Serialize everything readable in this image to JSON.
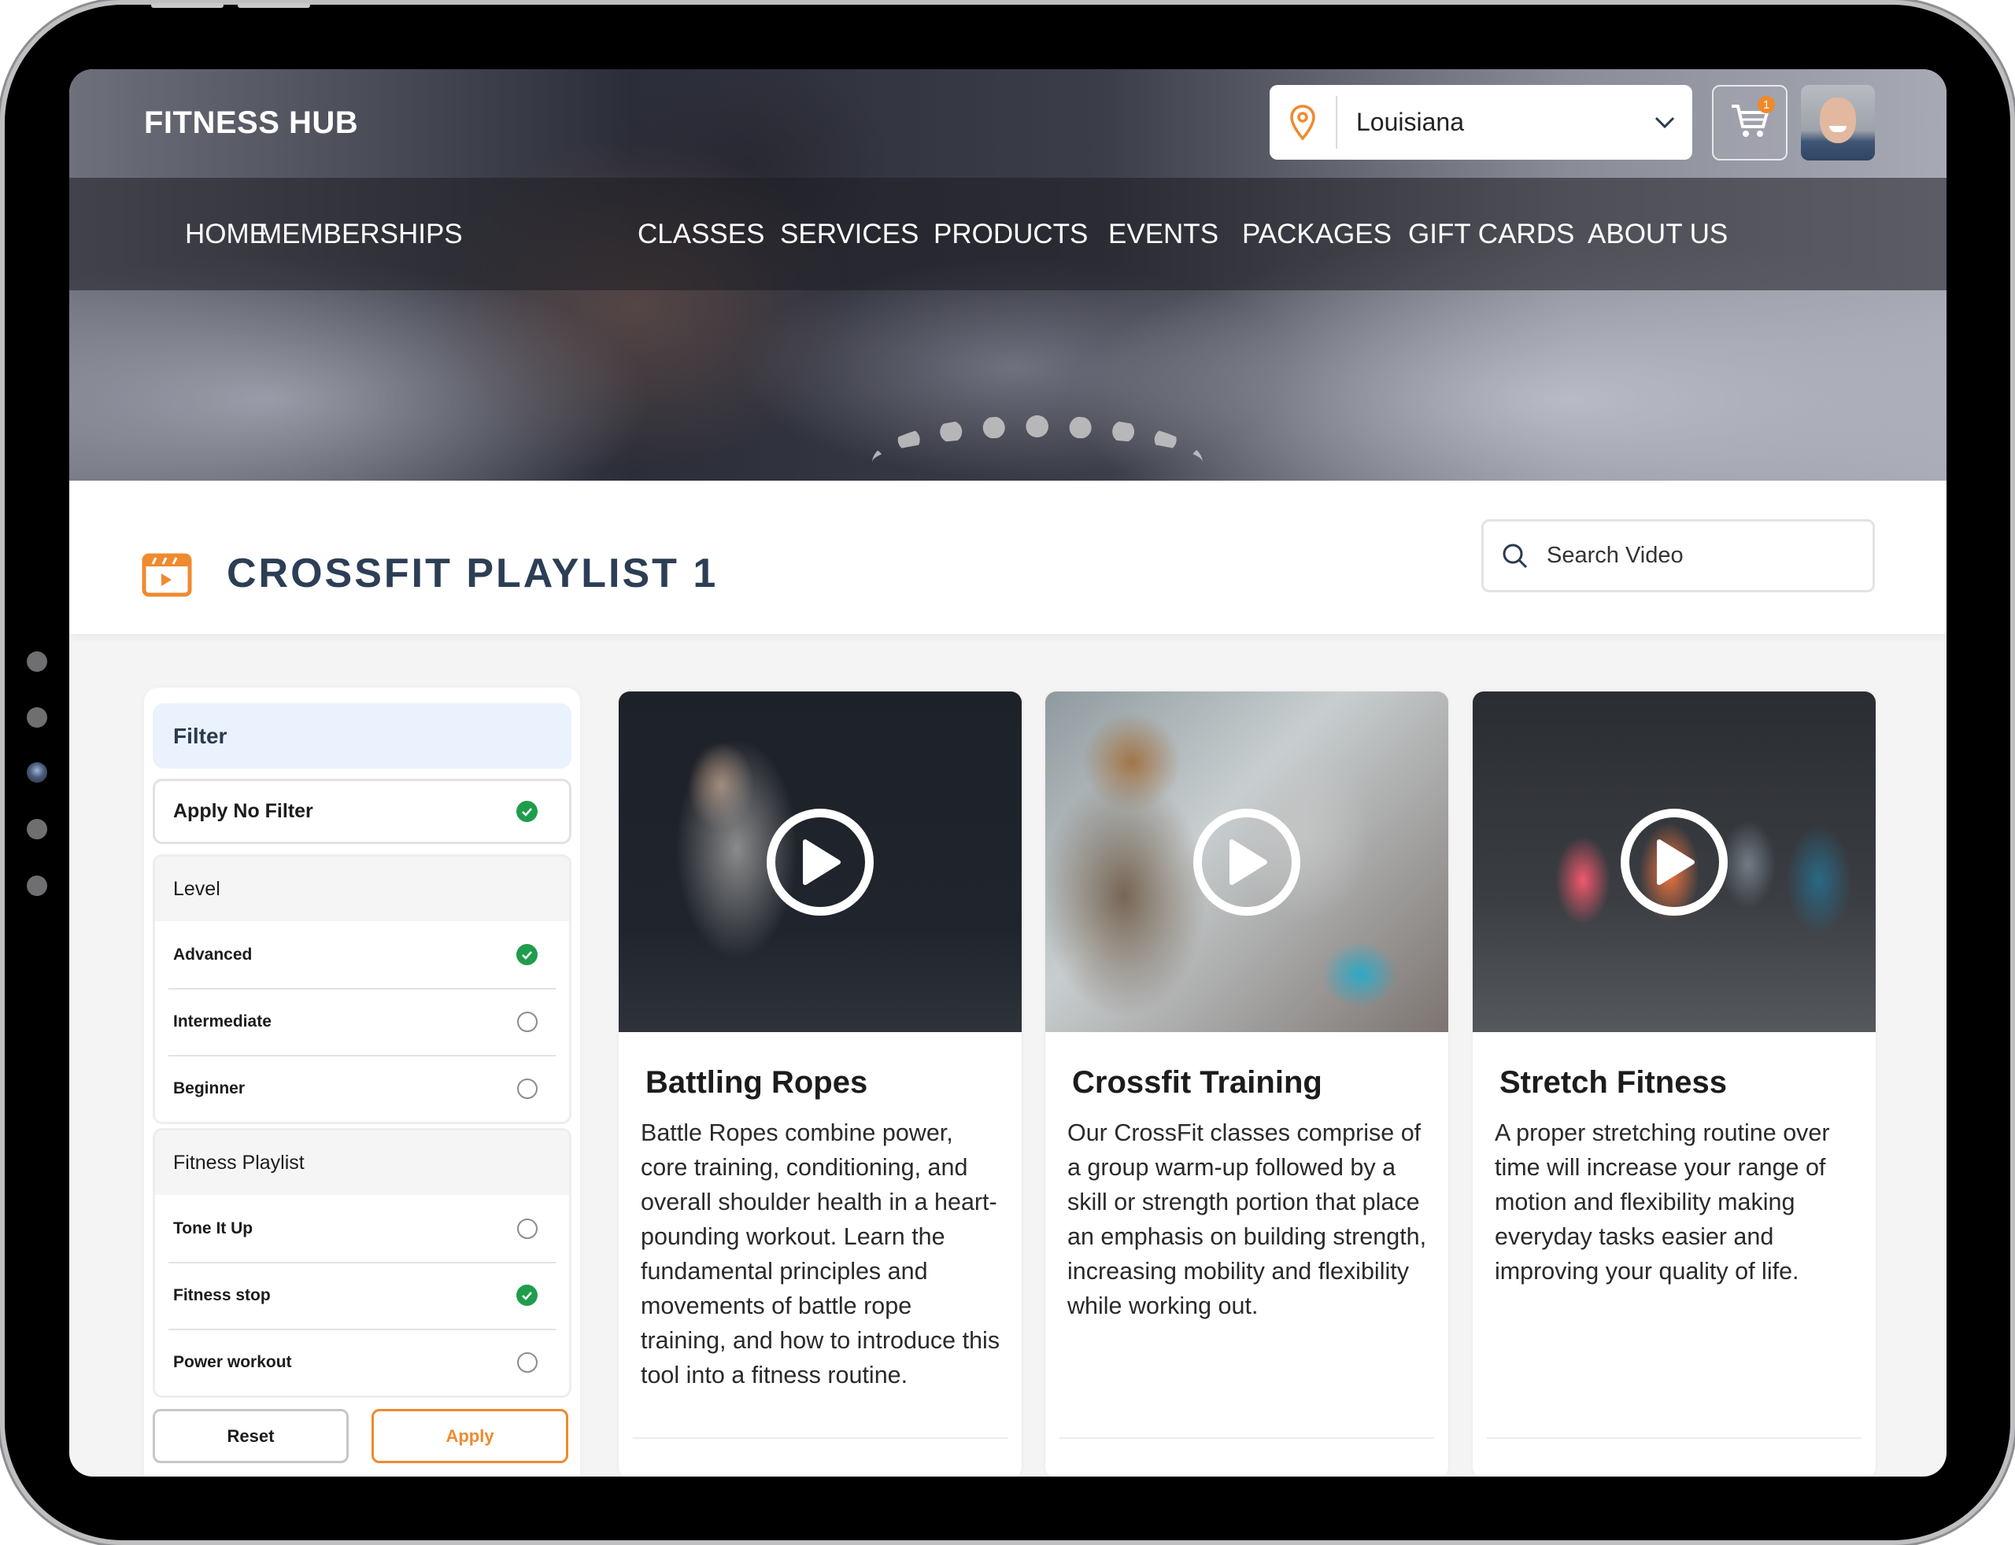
{
  "header": {
    "logo": "FITNESS HUB",
    "location": {
      "icon": "map-pin-icon",
      "value": "Louisiana",
      "dropdown_icon": "chevron-down-icon"
    },
    "cart": {
      "icon": "cart-icon",
      "badge_count": "1"
    },
    "avatar": "user-avatar"
  },
  "nav": {
    "items": [
      {
        "label": "HOME"
      },
      {
        "label": "MEMBERSHIPS"
      },
      {
        "label": "CLASSES"
      },
      {
        "label": "SERVICES"
      },
      {
        "label": "PRODUCTS"
      },
      {
        "label": "EVENTS"
      },
      {
        "label": "PACKAGES"
      },
      {
        "label": "GIFT CARDS"
      },
      {
        "label": "ABOUT US"
      }
    ]
  },
  "page": {
    "title": "CROSSFIT PLAYLIST 1",
    "title_icon": "video-clapperboard-icon",
    "search": {
      "placeholder": "Search Video",
      "value": ""
    }
  },
  "filter": {
    "title": "Filter",
    "no_filter": {
      "label": "Apply No Filter",
      "checked": true
    },
    "groups": [
      {
        "title": "Level",
        "options": [
          {
            "label": "Advanced",
            "checked": true
          },
          {
            "label": "Intermediate",
            "checked": false
          },
          {
            "label": "Beginner",
            "checked": false
          }
        ]
      },
      {
        "title": "Fitness Playlist",
        "options": [
          {
            "label": "Tone It Up",
            "checked": false
          },
          {
            "label": "Fitness stop",
            "checked": true
          },
          {
            "label": "Power workout",
            "checked": false
          }
        ]
      }
    ],
    "reset_label": "Reset",
    "apply_label": "Apply"
  },
  "videos": [
    {
      "title": "Battling Ropes",
      "description": "Battle Ropes combine power, core training, conditioning, and overall shoulder health in a heart-pounding workout. Learn the fundamental principles and movements of battle rope training, and how to introduce this tool into a fitness routine."
    },
    {
      "title": "Crossfit Training",
      "description": "Our CrossFit classes comprise of a group warm-up followed by a skill or strength portion that place an emphasis on building strength, increasing mobility and flexibility while working out."
    },
    {
      "title": "Stretch Fitness",
      "description": "A proper stretching routine over time will increase your range of motion and flexibility making everyday tasks easier and improving your quality of life."
    }
  ],
  "colors": {
    "accent": "#ef8a2f",
    "check_green": "#1f9d4c",
    "title_navy": "#2c3e55",
    "filter_header_bg": "#eaf2fd"
  }
}
